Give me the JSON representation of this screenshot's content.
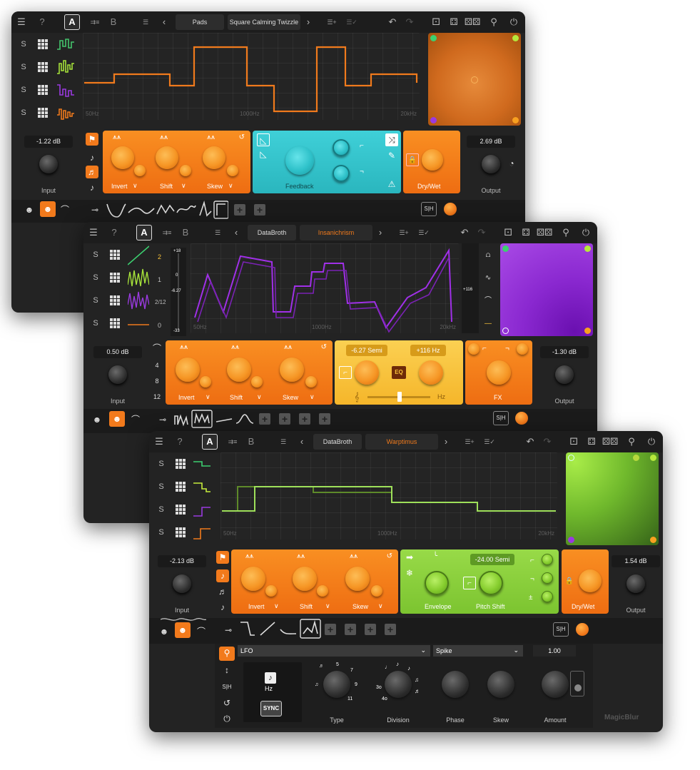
{
  "topbar": {
    "menu_icon": "hamburger-icon",
    "help": "?",
    "a": "A",
    "b": "B"
  },
  "w1": {
    "category": "Pads",
    "preset": "Square Calming Twizzle",
    "freq": [
      "50Hz",
      "1000Hz",
      "20kHz"
    ],
    "input": {
      "value": "-1.22 dB",
      "label": "Input"
    },
    "output": {
      "value": "2.69 dB",
      "label": "Output"
    },
    "labels": {
      "invert": "Invert",
      "shift": "Shift",
      "skew": "Skew",
      "feedback": "Feedback",
      "drywet": "Dry/Wet"
    },
    "sh": "S|H",
    "s": "S",
    "colors": {
      "xy": "#e07a28",
      "accent": "#f27a1c",
      "teal": "#2fc2ca",
      "line": "#f07a1c"
    }
  },
  "w2": {
    "category": "DataBroth",
    "preset": "Insanichrism",
    "freq": [
      "50Hz",
      "1000Hz",
      "20kHz"
    ],
    "rows": [
      "2",
      "1",
      "2/12",
      "0"
    ],
    "meter": [
      "+18",
      "0",
      "-6.27",
      "-33"
    ],
    "freqmeter": "+116",
    "input": {
      "value": "0.50 dB",
      "label": "Input"
    },
    "output": {
      "value": "-1.30 dB",
      "label": "Output"
    },
    "pitch": {
      "semi": "-6.27 Semi",
      "hz": "+116 Hz",
      "eq": "EQ",
      "hzunit": "Hz"
    },
    "side": [
      "4",
      "8",
      "12"
    ],
    "labels": {
      "invert": "Invert",
      "shift": "Shift",
      "skew": "Skew",
      "fx": "FX"
    },
    "sh": "S|H",
    "s": "S",
    "colors": {
      "xy": "#8a28d0",
      "line": "#a030e8",
      "yellow": "#f8c23a"
    }
  },
  "w3": {
    "category": "DataBroth",
    "preset": "Warptimus",
    "freq": [
      "50Hz",
      "1000Hz",
      "20kHz"
    ],
    "input": {
      "value": "-2.13 dB",
      "label": "Input"
    },
    "output": {
      "value": "1.54 dB",
      "label": "Output"
    },
    "env": {
      "semi": "-24.00 Semi",
      "envelope": "Envelope",
      "pitch": "Pitch Shift"
    },
    "labels": {
      "invert": "Invert",
      "shift": "Shift",
      "skew": "Skew",
      "drywet": "Dry/Wet"
    },
    "sh": "S|H",
    "s": "S",
    "lfo": {
      "title": "LFO",
      "hz": "Hz",
      "sync": "SYNC",
      "type": "Type",
      "division": "Division",
      "type_ticks": [
        "5",
        "7",
        "9",
        "11"
      ],
      "div_ticks": [
        "3o",
        "4o"
      ]
    },
    "spike": {
      "title": "Spike",
      "phase": "Phase",
      "skew": "Skew"
    },
    "amount": {
      "value": "1.00",
      "label": "Amount"
    },
    "brand": "MagicBlur",
    "colors": {
      "xy": "#7ac630",
      "line": "#9ee05a",
      "green": "#8ad03a"
    }
  }
}
